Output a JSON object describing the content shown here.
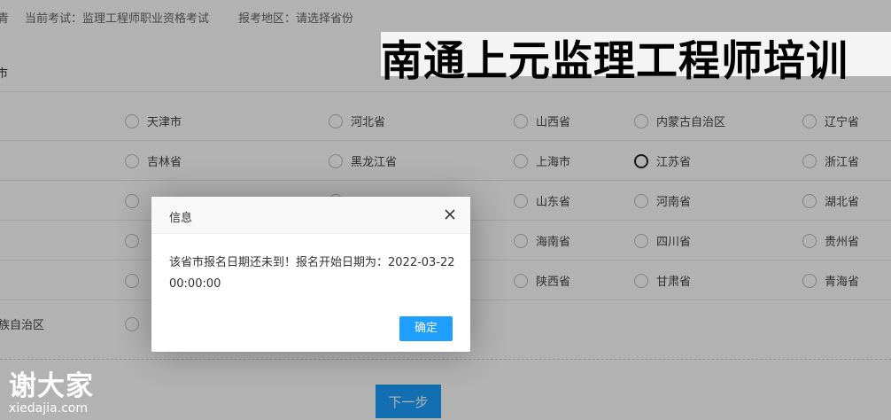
{
  "topbar": {
    "left_fragment": "青",
    "exam": "当前考试：监理工程师职业资格考试",
    "region": "报考地区：请选择省份"
  },
  "section_title_fragment": "市",
  "provinces": [
    [
      "天津市",
      "河北省",
      "山西省",
      "内蒙古自治区",
      "辽宁省"
    ],
    [
      "吉林省",
      "黑龙江省",
      "上海市",
      "江苏省",
      "浙江省"
    ],
    [
      "",
      "",
      "山东省",
      "河南省",
      "湖北省"
    ],
    [
      "",
      "",
      "海南省",
      "四川省",
      "贵州省"
    ],
    [
      "",
      "",
      "陕西省",
      "甘肃省",
      "青海省"
    ]
  ],
  "row6_label_fragment": "族自治区",
  "selected_province": "江苏省",
  "next_button": "下一步",
  "banner": "南通上元监理工程师培训",
  "watermark": {
    "cn": "谢大家",
    "en": "xiedajia.com"
  },
  "dialog": {
    "title": "信息",
    "message": "该省市报名日期还未到！报名开始日期为：2022-03-22 00:00:00",
    "ok_label": "确定"
  },
  "colors": {
    "primary": "#1e9fff",
    "overlay": "rgba(0,0,0,0.3)"
  }
}
